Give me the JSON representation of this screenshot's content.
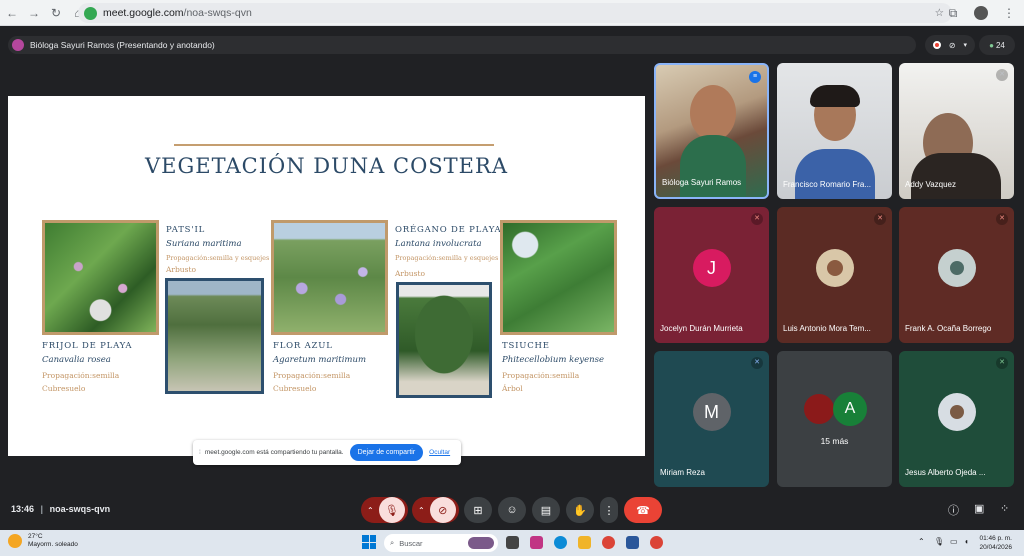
{
  "browser": {
    "url_host": "meet.google.com",
    "url_path": "/noa-swqs-qvn"
  },
  "meet": {
    "presenter_label": "Bióloga Sayuri Ramos (Presentando y anotando)",
    "participant_count": "24",
    "meeting_code": "noa-swqs-qvn",
    "time": "13:46",
    "separator": "|"
  },
  "slide": {
    "title": "VEGETACIÓN DUNA COSTERA",
    "species": [
      {
        "name": "FRIJOL DE PLAYA",
        "scientific": "Canavalia rosea",
        "propagation": "Propagación:semilla",
        "form": "Cubresuelo"
      },
      {
        "name": "PATS'IL",
        "scientific": "Suriana maritima",
        "propagation": "Propagación:semilla y esquejes",
        "form": "Arbusto"
      },
      {
        "name": "FLOR AZUL",
        "scientific": "Agaretum maritimum",
        "propagation": "Propagación:semilla",
        "form": "Cubresuelo"
      },
      {
        "name": "ORÉGANO DE PLAYA",
        "scientific": "Lantana involucrata",
        "propagation": "Propagación:semilla y esquejes",
        "form": "Arbusto"
      },
      {
        "name": "TSIUCHE",
        "scientific": "Phitecellobium keyense",
        "propagation": "Propagación:semilla",
        "form": "Árbol"
      }
    ]
  },
  "share_banner": {
    "message": "meet.google.com está compartiendo tu pantalla.",
    "stop_label": "Dejar de compartir",
    "hide_label": "Ocultar"
  },
  "participants": [
    {
      "name": "Bióloga Sayuri Ramos",
      "initial": ""
    },
    {
      "name": "Francisco Romario Fra...",
      "initial": ""
    },
    {
      "name": "Addy Vazquez",
      "initial": ""
    },
    {
      "name": "Jocelyn Durán Murrieta",
      "initial": "J"
    },
    {
      "name": "Luis Antonio Mora Tem...",
      "initial": ""
    },
    {
      "name": "Frank A. Ocaña Borrego",
      "initial": ""
    },
    {
      "name": "Miriam Reza",
      "initial": "M"
    },
    {
      "name": "15 más",
      "initial": "A"
    },
    {
      "name": "Jesus Alberto Ojeda ...",
      "initial": ""
    }
  ],
  "taskbar": {
    "temperature": "27°C",
    "weather": "Mayorm. soleado",
    "search_placeholder": "Buscar",
    "clock_time": "01:46 p. m.",
    "clock_date": "20/04/2026"
  },
  "colors": {
    "accent": "#1a73e8",
    "end_call": "#ea4335",
    "slide_title": "#2c4a67",
    "slide_frame": "#c09a6b"
  }
}
